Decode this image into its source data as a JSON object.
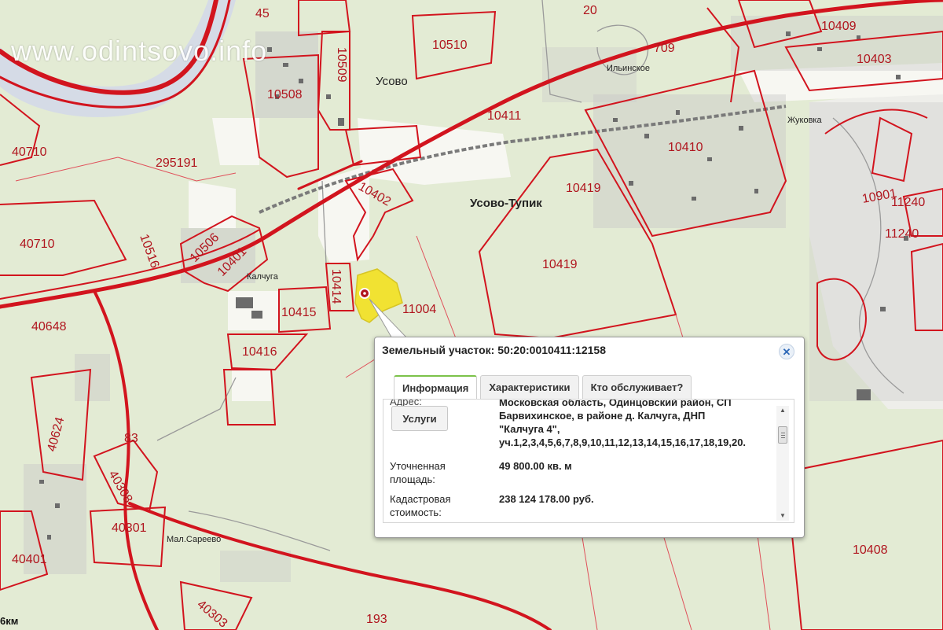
{
  "watermark": "www.odintsovo.info",
  "map": {
    "scale_label": "6км",
    "road_label": "20",
    "places": {
      "usovo": "Усово",
      "usovo_tupik": "Усово-Тупик",
      "ilinskoe": "Ильинское",
      "zhukovka": "Жуковка",
      "kalchuga": "Калчуга",
      "mal_sareevo": "Мал.Сареево"
    },
    "parcels": {
      "p10510": "10510",
      "p10509": "10509",
      "p10508": "10508",
      "p10411": "10411",
      "p10409": "10409",
      "p10403": "10403",
      "p709": "709",
      "p45": "45",
      "p40710a": "40710",
      "p40710b": "40710",
      "p295191": "295191",
      "p10402": "10402",
      "p10419a": "10419",
      "p10419b": "10419",
      "p10410": "10410",
      "p10506": "10506",
      "p10401": "10401",
      "p10516": "10516",
      "p10414": "10414",
      "p10415": "10415",
      "p11004": "11004",
      "p40648": "40648",
      "p10416": "10416",
      "p40624": "40624",
      "p83": "83",
      "p40308": "40308",
      "p40301": "40301",
      "p40401": "40401",
      "p40303": "40303",
      "p193": "193",
      "p10408": "10408",
      "p10901": "10901",
      "p11240a": "11240",
      "p11240b": "11240"
    }
  },
  "popup": {
    "title": "Земельный участок: 50:20:0010411:12158",
    "close_symbol": "✕",
    "tabs": [
      "Информация",
      "Характеристики",
      "Кто обслуживает?"
    ],
    "address_label": "Адрес:",
    "address_lines": [
      "Московская область, Одинцовский район, СП",
      "Барвихинское, в районе д. Калчуга, ДНП",
      "\"Калчуга 4\",",
      "уч.1,2,3,4,5,6,7,8,9,10,11,12,13,14,15,16,17,18,19,20."
    ],
    "services_button": "Услуги",
    "rows": [
      {
        "label": "Уточненная площадь:",
        "value": "49 800.00 кв. м"
      },
      {
        "label": "Кадастровая стоимость:",
        "value": "238 124 178.00 руб."
      }
    ]
  },
  "colors": {
    "boundary": "#d2141e",
    "river": "#d8dde8",
    "background": "#e4ecd6",
    "highlight": "#f2e22a",
    "tab_accent": "#7cc24a"
  }
}
